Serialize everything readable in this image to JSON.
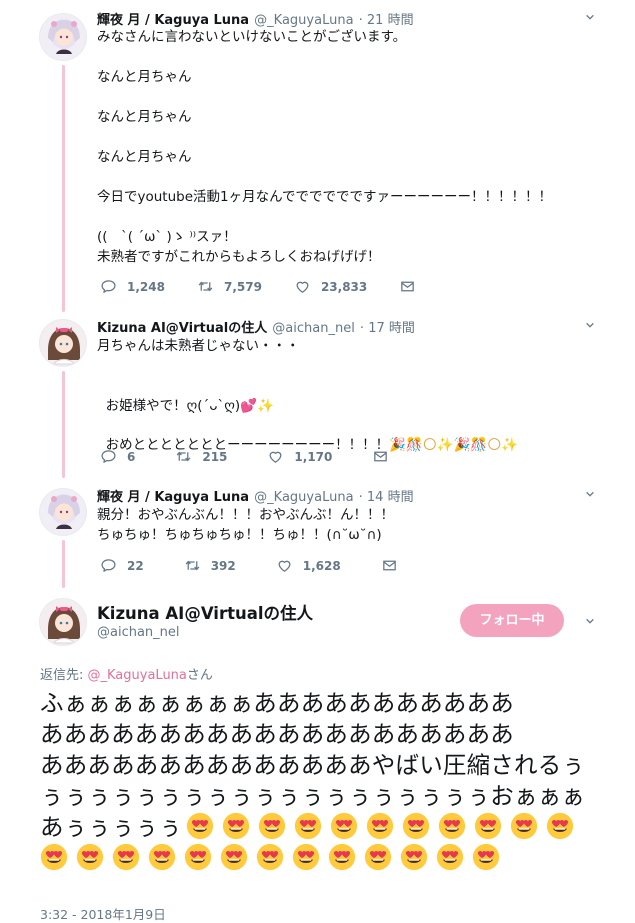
{
  "tweets": [
    {
      "name": "輝夜 月 / Kaguya Luna",
      "handle": "@_KaguyaLuna",
      "time": "21 時間",
      "text": "みなさんに言わないといけないことがございます。\n\nなんと月ちゃん\n\nなんと月ちゃん\n\nなんと月ちゃん\n\n今日でyoutube活動1ヶ月なんでででででですァーーーーーー！！！！！！\n\n((　`( ´ω` )ゝ ⁾⁾スァ！\n未熟者ですがこれからもよろしくおねげげげ！",
      "replies": "1,248",
      "retweets": "7,579",
      "likes": "23,833"
    },
    {
      "name": "Kizuna AI@Virtualの住人",
      "handle": "@aichan_nel",
      "time": "17 時間",
      "line1": "月ちゃんは未熟者じゃない・・・",
      "line2": "お姫様やで！ღ(´ᴗ`ღ)",
      "line3": "おめとととととととーーーーーーーー！！！！",
      "replies": "6",
      "retweets": "215",
      "likes": "1,170"
    },
    {
      "name": "輝夜 月 / Kaguya Luna",
      "handle": "@_KaguyaLuna",
      "time": "14 時間",
      "text": "親分！おやぶんぶん！！！おやぶんぶ！ん！！！\nちゅちゅ！ちゅちゅちゅ！！ちゅ！！(∩˘ω˘∩)",
      "replies": "22",
      "retweets": "392",
      "likes": "1,628"
    }
  ],
  "main": {
    "name": "Kizuna AI@Virtualの住人",
    "handle": "@aichan_nel",
    "follow_label": "フォロー中",
    "reply_prefix": "返信先: ",
    "reply_link": "@_KaguyaLuna",
    "reply_suffix": "さん",
    "text_line1": "ふぁぁぁぁぁぁぁぁあああああああああああ",
    "text_line2": "ああああああああああああああああああああ",
    "text_line3": "ああああああああああああああやばい圧縮されるぅ",
    "text_line4": "ぅぅぅぅぅぅぅぅぅぅぅぅぅぅぅぅぅぅぅおぁぁぁ",
    "text_line5": "あぅぅぅぅぅ",
    "emoji_name": "heart-eyes-emoji",
    "emoji_count_line5": 11,
    "emoji_count_line6": 13,
    "timestamp": "3:32 - 2018年1月9日"
  },
  "icons": {
    "reply": "reply-icon",
    "retweet": "retweet-icon",
    "like": "heart-icon",
    "dm": "envelope-icon",
    "menu": "chevron-down-icon"
  },
  "colors": {
    "thread_line": "#f5c4d6",
    "follow_button": "#f4a3bf",
    "link": "#e46f99",
    "meta": "#657786"
  }
}
